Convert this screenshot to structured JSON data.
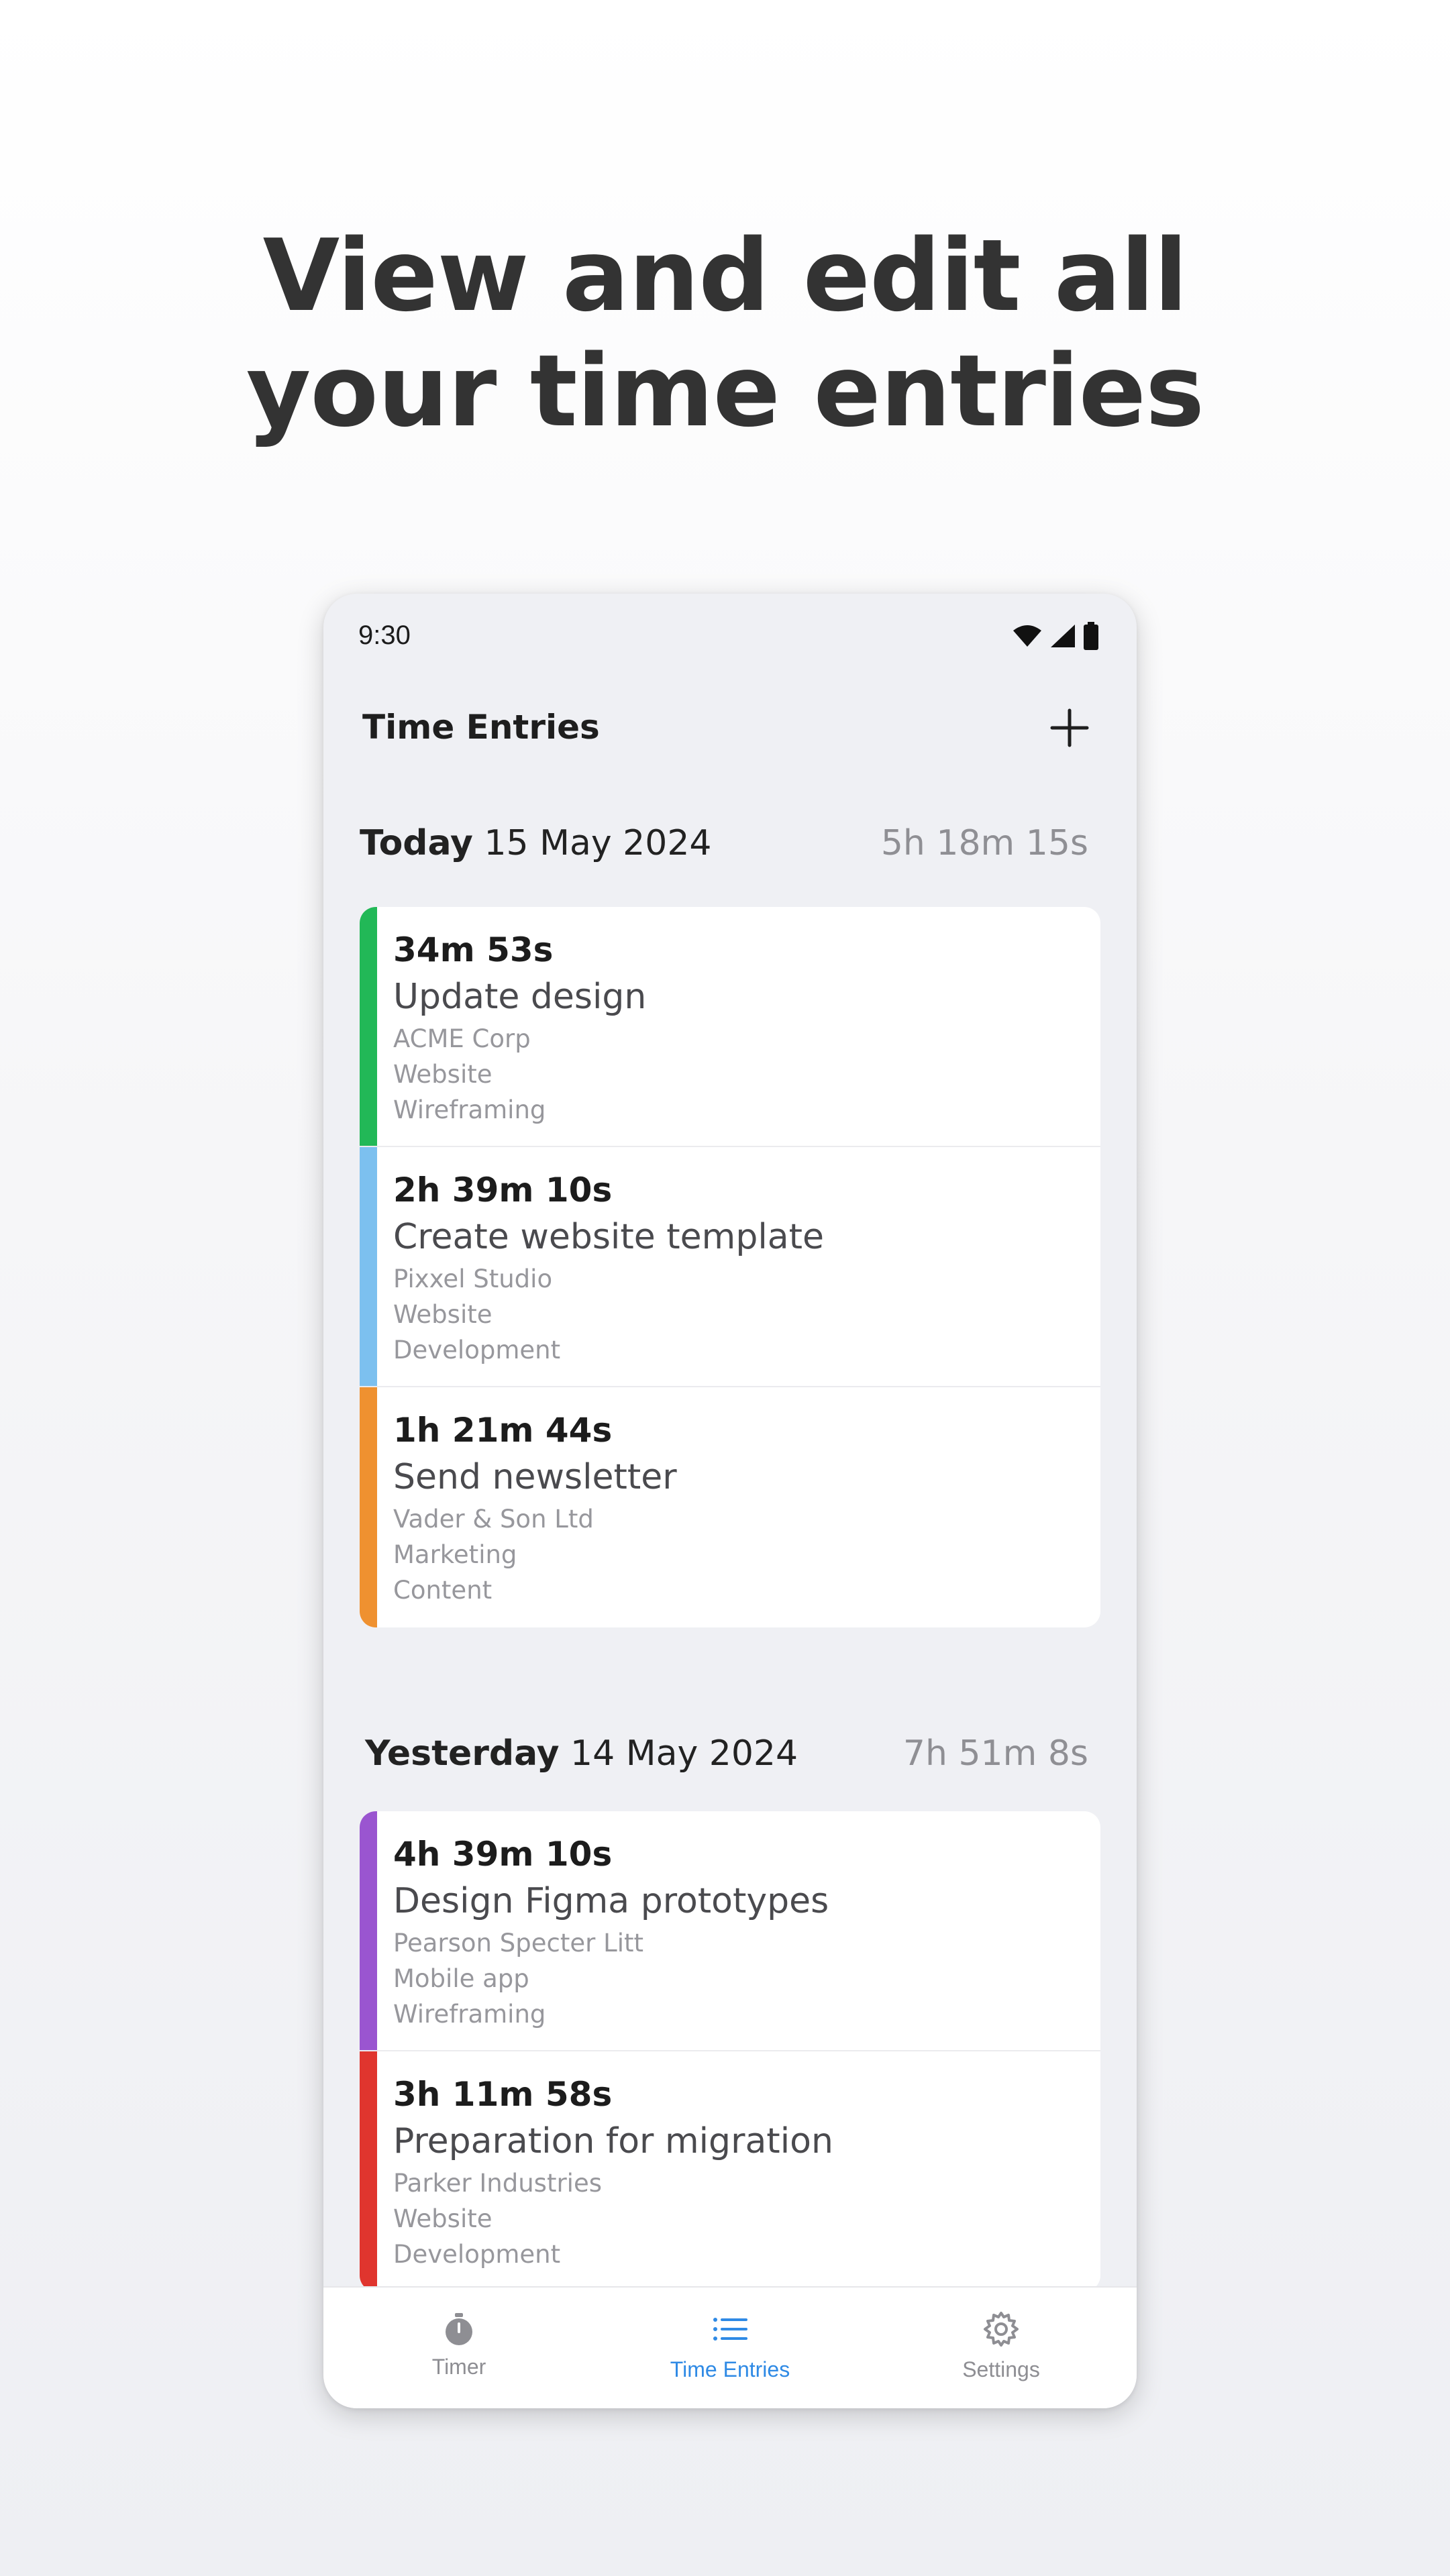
{
  "promo": {
    "headline_line1": "View and edit all",
    "headline_line2": "your time entries"
  },
  "status_bar": {
    "time": "9:30",
    "icons": [
      "wifi-icon",
      "signal-icon",
      "battery-icon"
    ]
  },
  "app_bar": {
    "title": "Time Entries",
    "add_icon": "plus-icon"
  },
  "days": [
    {
      "label_bold": "Today",
      "date": "15 May 2024",
      "total": "5h 18m 15s",
      "entries": [
        {
          "duration": "34m 53s",
          "description": "Update design",
          "client": "ACME Corp",
          "project": "Website",
          "task": "Wireframing",
          "color": "#22b857"
        },
        {
          "duration": "2h 39m 10s",
          "description": "Create website template",
          "client": "Pixxel Studio",
          "project": "Website",
          "task": "Development",
          "color": "#7cc0ef"
        },
        {
          "duration": "1h 21m 44s",
          "description": "Send newsletter",
          "client": "Vader & Son Ltd",
          "project": "Marketing",
          "task": "Content",
          "color": "#ef9130"
        }
      ]
    },
    {
      "label_bold": "Yesterday",
      "date": "14 May 2024",
      "total": "7h 51m 8s",
      "entries": [
        {
          "duration": "4h 39m 10s",
          "description": "Design Figma prototypes",
          "client": "Pearson Specter Litt",
          "project": "Mobile app",
          "task": "Wireframing",
          "color": "#9a55d0"
        },
        {
          "duration": "3h 11m 58s",
          "description": "Preparation for migration",
          "client": "Parker Industries",
          "project": "Website",
          "task": "Development",
          "color": "#e0352e"
        }
      ]
    }
  ],
  "bottom_nav": [
    {
      "label": "Timer",
      "icon": "stopwatch-icon",
      "active": false
    },
    {
      "label": "Time Entries",
      "icon": "list-icon",
      "active": true
    },
    {
      "label": "Settings",
      "icon": "gear-icon",
      "active": false
    }
  ],
  "colors": {
    "accent": "#2f8ae5",
    "nav_inactive": "#8e8e93"
  }
}
